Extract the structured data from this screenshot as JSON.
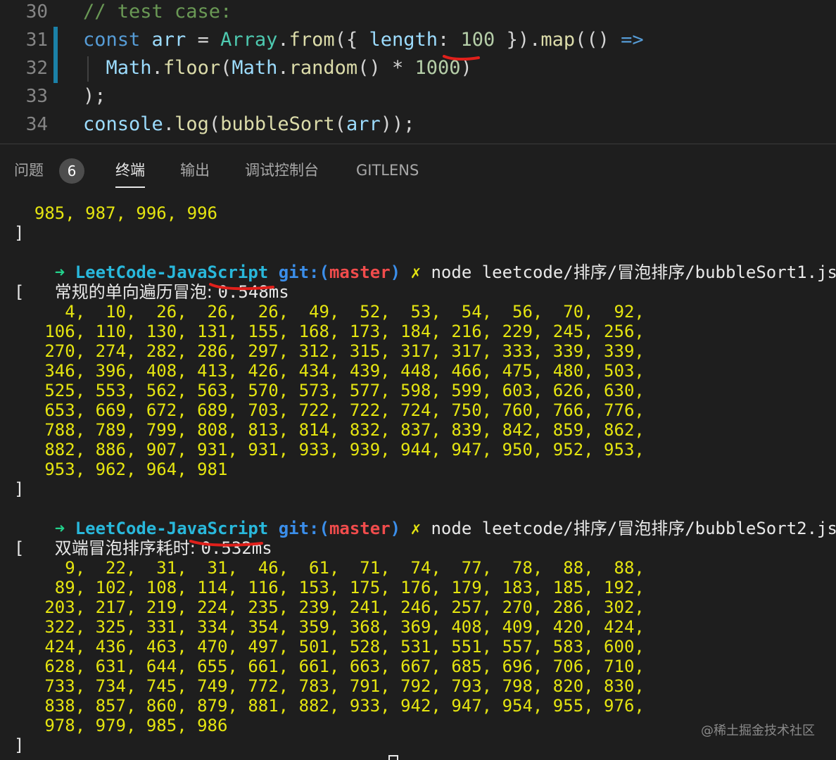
{
  "editor": {
    "lines": [
      {
        "num": "30",
        "tokens": [
          {
            "t": "// test case:",
            "c": "comment"
          }
        ]
      },
      {
        "num": "31",
        "tokens": [
          {
            "t": "const",
            "c": "keyword"
          },
          {
            "t": " ",
            "c": "op"
          },
          {
            "t": "arr",
            "c": "var"
          },
          {
            "t": " = ",
            "c": "op"
          },
          {
            "t": "Array",
            "c": "class"
          },
          {
            "t": ".",
            "c": "op"
          },
          {
            "t": "from",
            "c": "func"
          },
          {
            "t": "({ ",
            "c": "op"
          },
          {
            "t": "length",
            "c": "var"
          },
          {
            "t": ": ",
            "c": "op"
          },
          {
            "t": "100",
            "c": "num"
          },
          {
            "t": " }).",
            "c": "op"
          },
          {
            "t": "map",
            "c": "func"
          },
          {
            "t": "(() ",
            "c": "op"
          },
          {
            "t": "=>",
            "c": "arrow"
          }
        ]
      },
      {
        "num": "32",
        "tokens": [
          {
            "t": "  ",
            "c": "op"
          },
          {
            "t": "Math",
            "c": "var"
          },
          {
            "t": ".",
            "c": "op"
          },
          {
            "t": "floor",
            "c": "func"
          },
          {
            "t": "(",
            "c": "op"
          },
          {
            "t": "Math",
            "c": "var"
          },
          {
            "t": ".",
            "c": "op"
          },
          {
            "t": "random",
            "c": "func"
          },
          {
            "t": "() * ",
            "c": "op"
          },
          {
            "t": "1000",
            "c": "num"
          },
          {
            "t": ")",
            "c": "op"
          }
        ]
      },
      {
        "num": "33",
        "tokens": [
          {
            "t": ");",
            "c": "op"
          }
        ]
      },
      {
        "num": "34",
        "tokens": [
          {
            "t": "console",
            "c": "var"
          },
          {
            "t": ".",
            "c": "op"
          },
          {
            "t": "log",
            "c": "func"
          },
          {
            "t": "(",
            "c": "op"
          },
          {
            "t": "bubbleSort",
            "c": "func"
          },
          {
            "t": "(",
            "c": "op"
          },
          {
            "t": "arr",
            "c": "var"
          },
          {
            "t": "));",
            "c": "op"
          }
        ]
      }
    ]
  },
  "panel": {
    "tabs": {
      "problems": "问题",
      "problems_count": "6",
      "terminal": "终端",
      "output": "输出",
      "debug_console": "调试控制台",
      "gitlens": "GITLENS"
    }
  },
  "terminal": {
    "pre_tail": "  985, 987, 996, 996",
    "close_bracket": "]",
    "open_bracket": "[",
    "prompt": {
      "arrow": "➜",
      "repo": "LeetCode-JavaScript",
      "git_label": "git:(",
      "branch": "master",
      "git_close": ")",
      "dirty": "✗"
    },
    "run1": {
      "command": "node leetcode/排序/冒泡排序/bubbleSort1.js",
      "timing_label": "常规的单向遍历冒泡: ",
      "timing_value": "0.548ms",
      "rows": [
        "     4,  10,  26,  26,  26,  49,  52,  53,  54,  56,  70,  92,",
        "   106, 110, 130, 131, 155, 168, 173, 184, 216, 229, 245, 256,",
        "   270, 274, 282, 286, 297, 312, 315, 317, 317, 333, 339, 339,",
        "   346, 396, 408, 413, 426, 434, 439, 448, 466, 475, 480, 503,",
        "   525, 553, 562, 563, 570, 573, 577, 598, 599, 603, 626, 630,",
        "   653, 669, 672, 689, 703, 722, 722, 724, 750, 760, 766, 776,",
        "   788, 789, 799, 808, 813, 814, 832, 837, 839, 842, 859, 862,",
        "   882, 886, 907, 931, 931, 933, 939, 944, 947, 950, 952, 953,",
        "   953, 962, 964, 981"
      ]
    },
    "run2": {
      "command": "node leetcode/排序/冒泡排序/bubbleSort2.js",
      "timing_label": "双端冒泡排序耗时: ",
      "timing_value": "0.532ms",
      "rows": [
        "     9,  22,  31,  31,  46,  61,  71,  74,  77,  78,  88,  88,",
        "    89, 102, 108, 114, 116, 153, 175, 176, 179, 183, 185, 192,",
        "   203, 217, 219, 224, 235, 239, 241, 246, 257, 270, 286, 302,",
        "   322, 325, 331, 334, 354, 359, 368, 369, 408, 409, 420, 424,",
        "   424, 436, 463, 470, 497, 501, 528, 531, 551, 557, 583, 600,",
        "   628, 631, 644, 655, 661, 661, 663, 667, 685, 696, 706, 710,",
        "   733, 734, 745, 749, 772, 783, 791, 792, 793, 798, 820, 830,",
        "   838, 857, 860, 879, 881, 882, 933, 942, 947, 954, 955, 976,",
        "   978, 979, 985, 986"
      ]
    }
  },
  "watermark": "@稀土掘金技术社区",
  "colors": {
    "background": "#1e1e1e",
    "numbers": "#e5e510",
    "annotation": "#e0201b"
  }
}
